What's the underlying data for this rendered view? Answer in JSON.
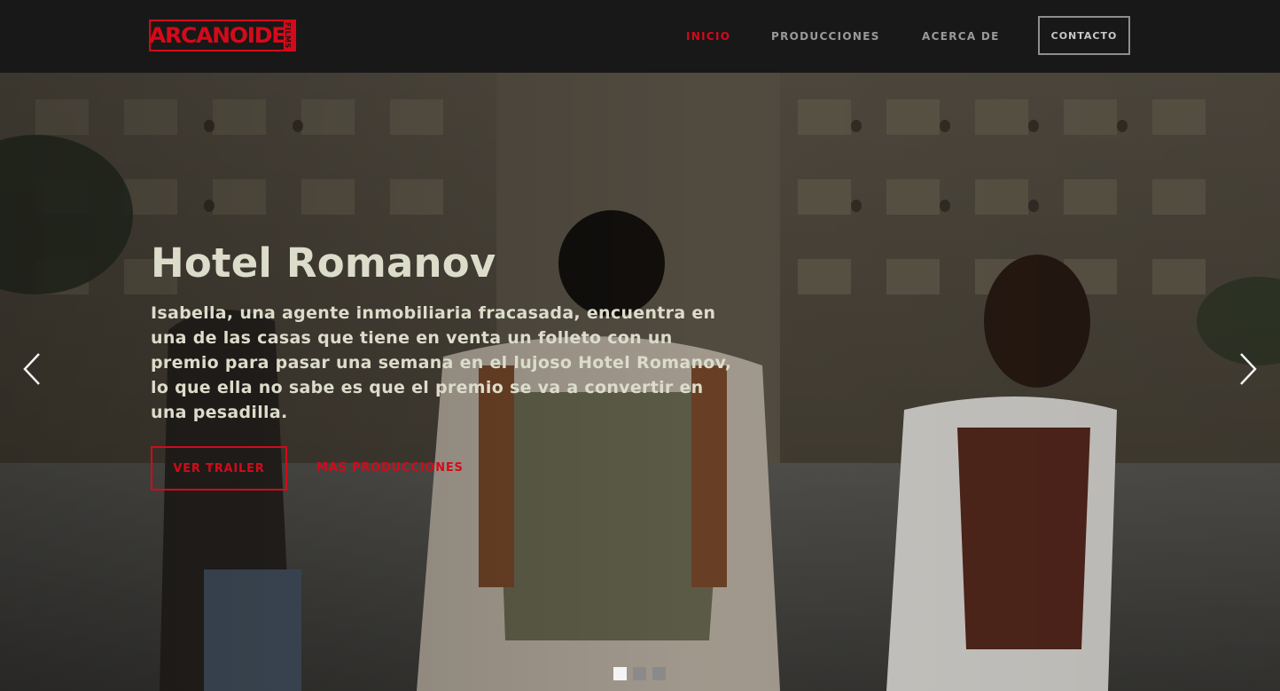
{
  "brand": {
    "logo_text": "ARCANOIDE",
    "logo_side_text": "FILMS",
    "accent_color": "#d40a1a"
  },
  "nav": {
    "items": [
      {
        "label": "INICIO",
        "active": true
      },
      {
        "label": "PRODUCCIONES",
        "active": false
      },
      {
        "label": "ACERCA DE",
        "active": false
      }
    ],
    "contact_label": "CONTACTO"
  },
  "hero": {
    "title": "Hotel Romanov",
    "description": "Isabella, una agente inmobiliaria fracasada, encuentra en una de las casas que tiene en venta un folleto con un premio para pasar una semana en el lujoso Hotel Romanov, lo que ella no sabe es que el premio se va a convertir en una pesadilla.",
    "trailer_button": "VER TRAILER",
    "more_link": "MAS PRODUCCIONES",
    "prev_icon": "chevron-left-icon",
    "next_icon": "chevron-right-icon",
    "slides_total": 3,
    "active_slide": 1
  }
}
